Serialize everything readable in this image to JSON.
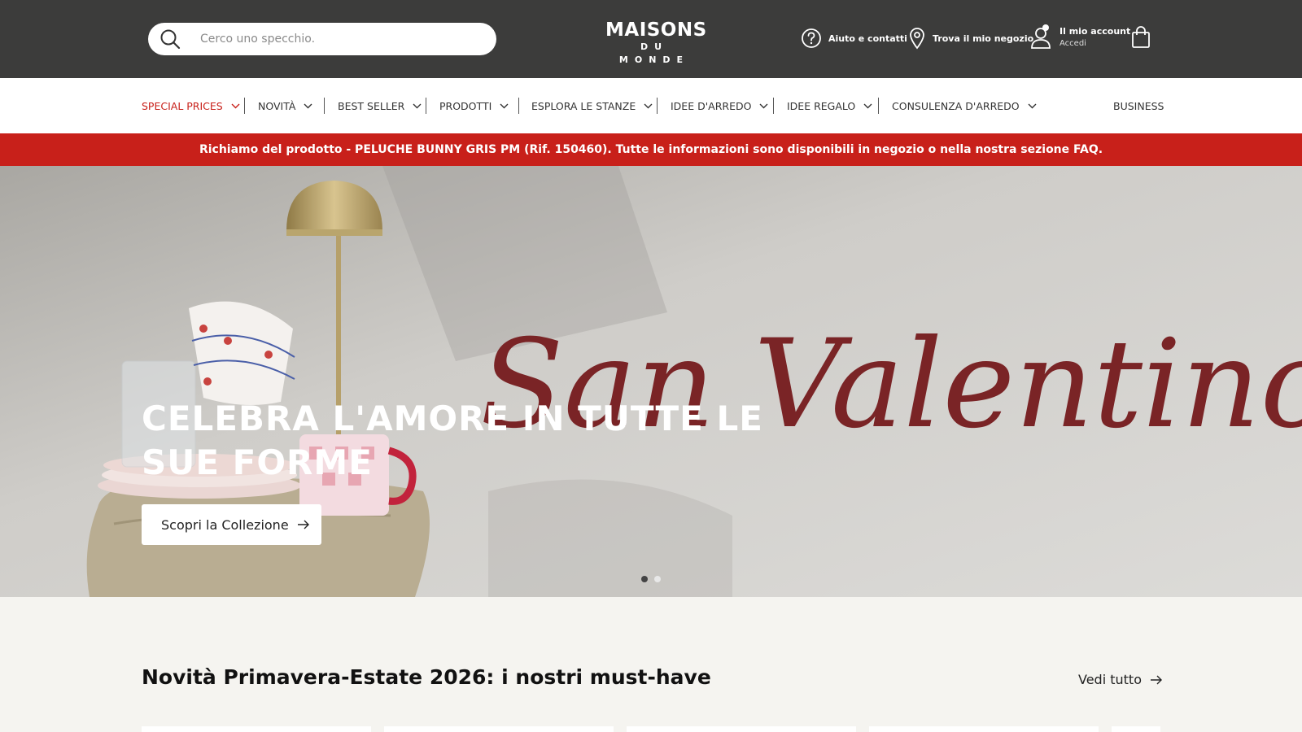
{
  "header": {
    "search": {
      "placeholder": "Cerco uno specchio."
    },
    "logo": {
      "line1": "MAISONS",
      "line2": "DU MONDE"
    },
    "help_label": "Aiuto e contatti",
    "store_label": "Trova il mio negozio",
    "account_label": "Il mio account",
    "account_sub": "Accedi"
  },
  "nav": {
    "items": [
      {
        "label": "SPECIAL PRICES"
      },
      {
        "label": "NOVITÀ"
      },
      {
        "label": "BEST SELLER"
      },
      {
        "label": "PRODOTTI"
      },
      {
        "label": "ESPLORA LE STANZE"
      },
      {
        "label": "IDEE D'ARREDO"
      },
      {
        "label": "IDEE REGALO"
      },
      {
        "label": "CONSULENZA D'ARREDO"
      }
    ],
    "business_label": "BUSINESS"
  },
  "recall": {
    "text": "Richiamo del prodotto - PELUCHE BUNNY GRIS PM (Rif. 150460). Tutte le informazioni sono disponibili in negozio o nella nostra sezione FAQ."
  },
  "hero": {
    "script_text": "San Valentino",
    "title": "CELEBRA L'AMORE IN TUTTE LE SUE FORME",
    "cta_label": "Scopri la Collezione",
    "slides": 2,
    "active_slide": 1
  },
  "section": {
    "title": "Novità Primavera-Estate 2026: i nostri must-have",
    "see_all_label": "Vedi tutto"
  },
  "colors": {
    "header_bg": "#3c3c3b",
    "accent_red": "#c8201a",
    "page_bg": "#f5f4f0",
    "script_red": "#7a2426"
  }
}
